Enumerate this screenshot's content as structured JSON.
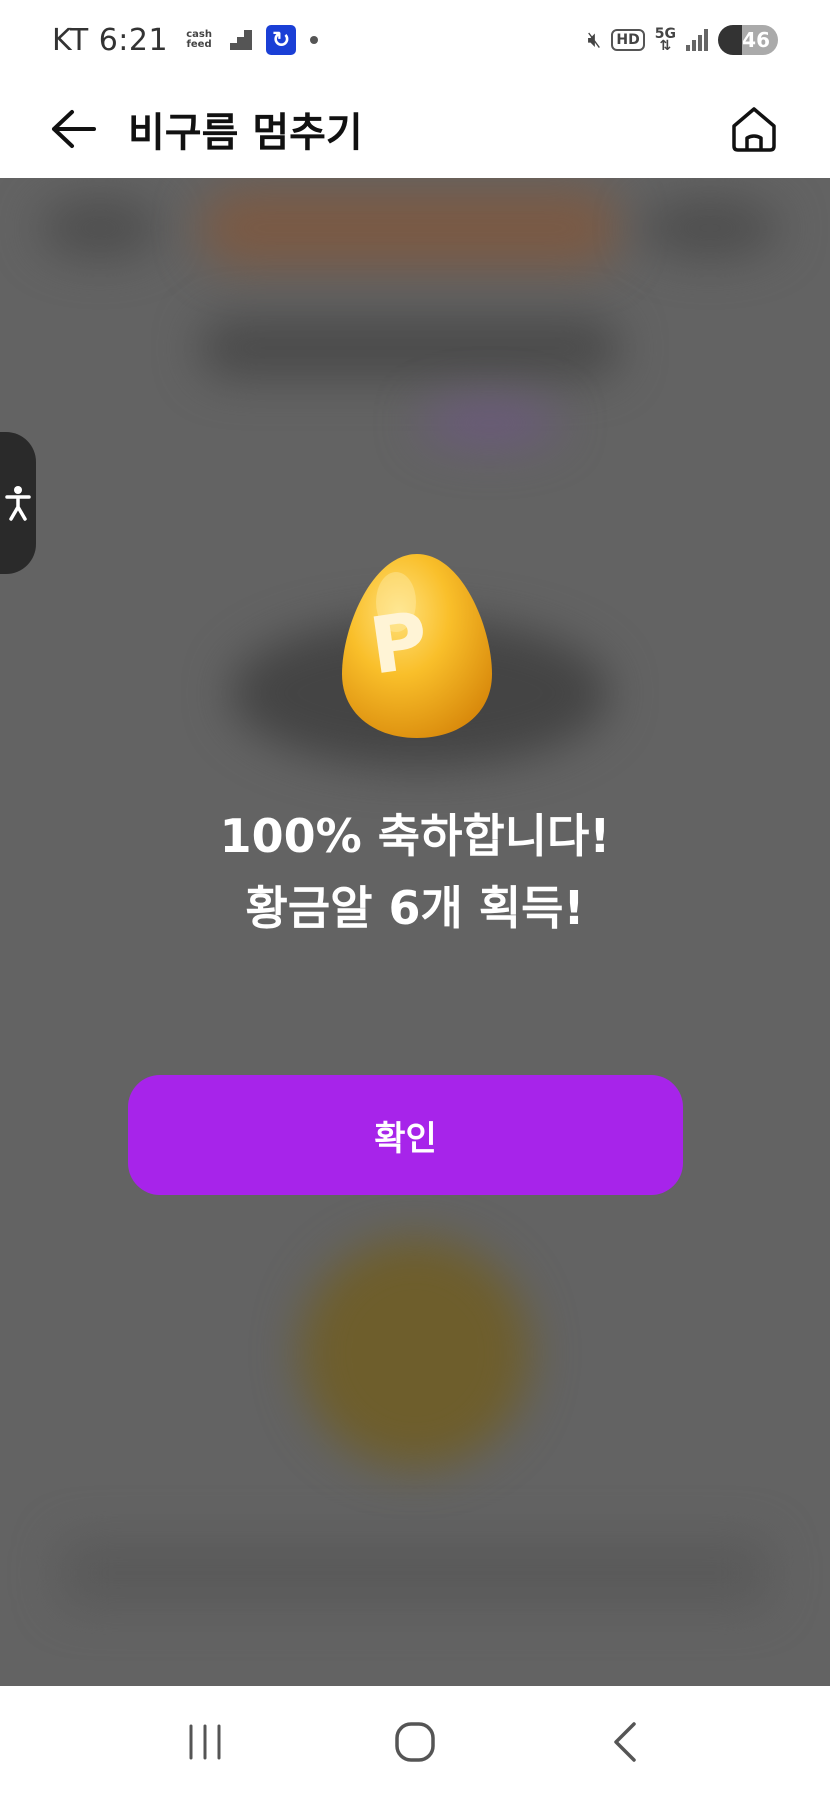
{
  "status_bar": {
    "carrier": "KT",
    "time": "6:21",
    "cashfeed_label": "cash feed",
    "network": "5G",
    "hd_label": "HD",
    "battery": "46"
  },
  "header": {
    "title": "비구름 멈추기"
  },
  "modal": {
    "egg_letter": "P",
    "line1": "100% 축하합니다!",
    "line2": "황금알 6개 획득!",
    "confirm_label": "확인"
  },
  "colors": {
    "accent": "#a724ea",
    "overlay": "#636363",
    "egg_gold": "#f5b21c"
  }
}
